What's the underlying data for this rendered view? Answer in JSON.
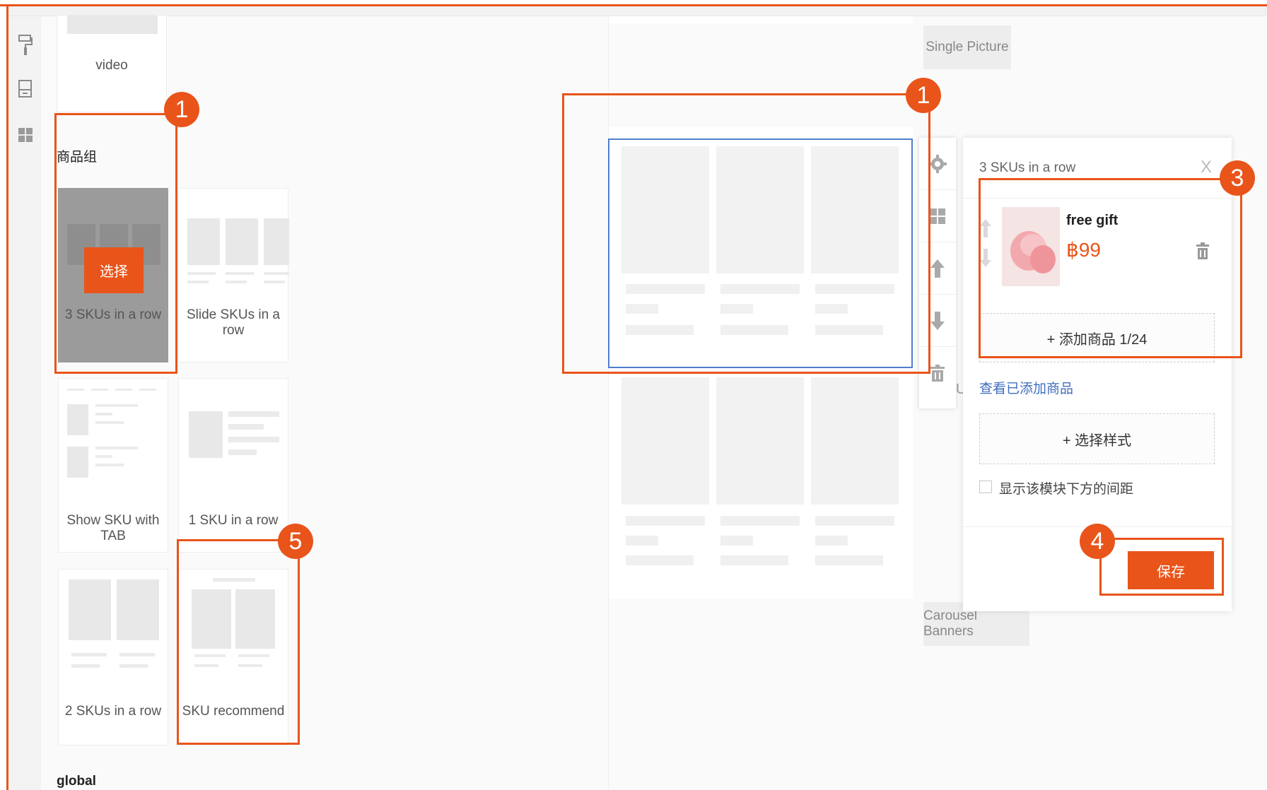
{
  "sidebar_icons": [
    "paint-roller-icon",
    "page-layout-icon",
    "grid-icon"
  ],
  "widgets": {
    "video_label": "video",
    "section_product_group": "商品组",
    "select_button_label": "选择",
    "items": [
      {
        "label": "3 SKUs in a row"
      },
      {
        "label": "Slide SKUs in a row"
      },
      {
        "label": "Show SKU with TAB"
      },
      {
        "label": "1 SKU in a row"
      },
      {
        "label": "2 SKUs in a row"
      },
      {
        "label": "SKU recommend"
      }
    ],
    "section_global": "global"
  },
  "canvas": {
    "tag_single_picture": "Single Picture",
    "tag_carousel_banners": "Carousel Banners",
    "stray_letter": "U"
  },
  "toolbar_icons": [
    "gear-icon",
    "grid-icon",
    "arrow-up-icon",
    "arrow-down-icon",
    "trash-icon"
  ],
  "settings": {
    "title": "3 SKUs in a row",
    "close_glyph": "X",
    "product": {
      "name": "free gift",
      "price": "฿99"
    },
    "add_product_label": "+ 添加商品 1/24",
    "view_added_link": "查看已添加商品",
    "choose_style_label": "+ 选择样式",
    "spacing_checkbox_label": "显示该模块下方的间距",
    "spacing_checked": false,
    "save_label": "保存"
  },
  "annotations": [
    "1",
    "1",
    "3",
    "4",
    "5"
  ],
  "colors": {
    "accent": "#e9541a",
    "selection_blue": "#4f7fce",
    "price_red": "#e9541a"
  }
}
